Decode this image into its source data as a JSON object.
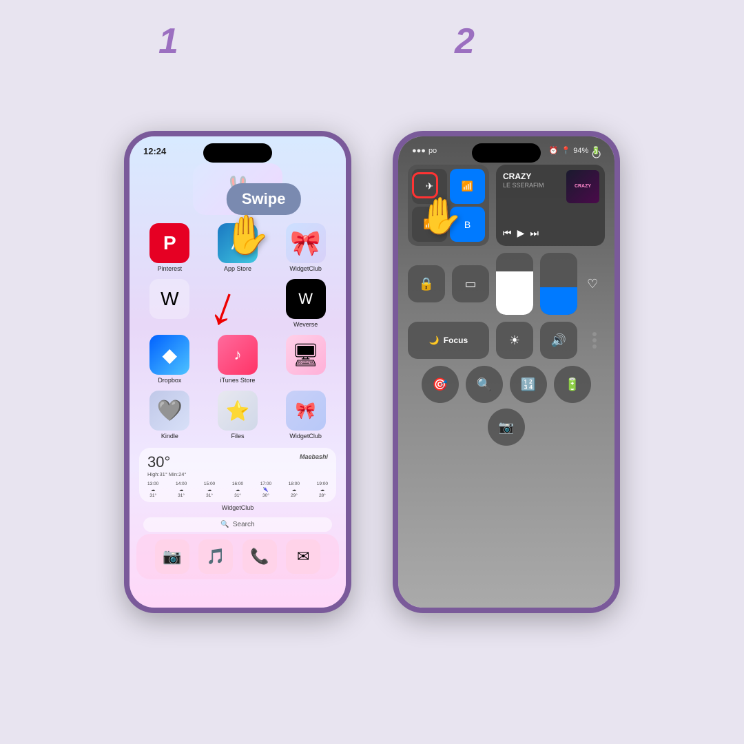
{
  "background_color": "#e8e4f0",
  "step1": {
    "number": "1",
    "swipe_label": "Swipe",
    "status_time": "12:24",
    "apps": [
      {
        "id": "pinterest",
        "label": "Pinterest",
        "icon": "P"
      },
      {
        "id": "appstore",
        "label": "App Store",
        "icon": "A"
      },
      {
        "id": "widgetclub-top",
        "label": "WidgetClub",
        "icon": "🎀"
      },
      {
        "id": "weverse",
        "label": "W",
        "icon": "W"
      },
      {
        "id": "weverse-full",
        "label": "Weverse",
        "icon": "W"
      },
      {
        "id": "dropbox",
        "label": "Dropbox",
        "icon": "◆"
      },
      {
        "id": "itunes",
        "label": "iTunes Store",
        "icon": "♪"
      },
      {
        "id": "pc-widget",
        "label": "",
        "icon": "🖥"
      },
      {
        "id": "kindle",
        "label": "Kindle",
        "icon": "🩶"
      },
      {
        "id": "files",
        "label": "Files",
        "icon": "⭐"
      },
      {
        "id": "widgetclub-bot",
        "label": "WidgetClub",
        "icon": "🎀"
      }
    ],
    "weather": {
      "temp": "30°",
      "high_low": "High:31° Min:24°",
      "city": "Maebashi",
      "hours": [
        "13:00",
        "14:00",
        "15:00",
        "16:00",
        "17:00",
        "18:00",
        "19:00"
      ],
      "temps": [
        "31°",
        "31°",
        "31°",
        "31°",
        "30°",
        "29°",
        "28°"
      ]
    },
    "widget_label": "WidgetClub",
    "search_placeholder": "Search",
    "dock_icons": [
      "📷",
      "🎵",
      "📞",
      "✉"
    ]
  },
  "step2": {
    "number": "2",
    "plus_button_label": "+",
    "status": {
      "signal": "●●●●",
      "carrier": "po",
      "alarm": "⏰",
      "battery": "94%"
    },
    "now_playing": {
      "title": "CRAZY",
      "artist": "LE SSERAFIM",
      "art_label": "CRAZY"
    },
    "connectivity": [
      "✈",
      "wifi",
      "bt",
      "circle"
    ],
    "focus_label": "Focus",
    "sliders": {
      "brightness_pct": 70,
      "volume_pct": 45
    },
    "bottom_icons": [
      "🎯",
      "🔍",
      "🧮",
      "🔋"
    ],
    "camera_icon": "📷",
    "power_icon": "⏻"
  }
}
